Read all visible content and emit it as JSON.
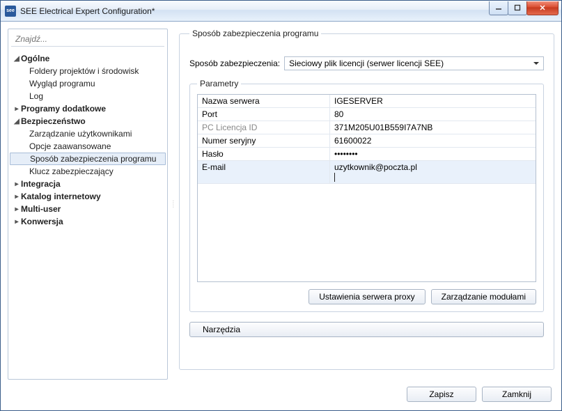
{
  "window": {
    "title": "SEE Electrical Expert Configuration*"
  },
  "sidebar": {
    "search_placeholder": "Znajdź...",
    "nodes": {
      "general": "Ogólne",
      "general_children": [
        "Foldery projektów i środowisk",
        "Wygląd programu",
        "Log"
      ],
      "extra": "Programy dodatkowe",
      "security": "Bezpieczeństwo",
      "security_children": [
        "Zarządzanie użytkownikami",
        "Opcje zaawansowane",
        "Sposób zabezpieczenia programu",
        "Klucz zabezpieczający"
      ],
      "integration": "Integracja",
      "catalog": "Katalog internetowy",
      "multiuser": "Multi-user",
      "conversion": "Konwersja"
    }
  },
  "panel": {
    "group_title": "Sposób zabezpieczenia programu",
    "method_label": "Sposób zabezpieczenia:",
    "method_value": "Sieciowy plik licencji (serwer licencji SEE)",
    "params_title": "Parametry",
    "params": {
      "server_k": "Nazwa serwera",
      "server_v": "IGESERVER",
      "port_k": "Port",
      "port_v": "80",
      "licid_k": "PC Licencja ID",
      "licid_v": "371M205U01B559I7A7NB",
      "serial_k": "Numer seryjny",
      "serial_v": "61600022",
      "pwd_k": "Hasło",
      "pwd_v": "••••••••",
      "email_k": "E-mail",
      "email_v": "uzytkownik@poczta.pl"
    },
    "proxy_btn": "Ustawienia serwera proxy",
    "modules_btn": "Zarządzanie modułami",
    "tools_btn": "Narzędzia"
  },
  "footer": {
    "save": "Zapisz",
    "close": "Zamknij"
  }
}
